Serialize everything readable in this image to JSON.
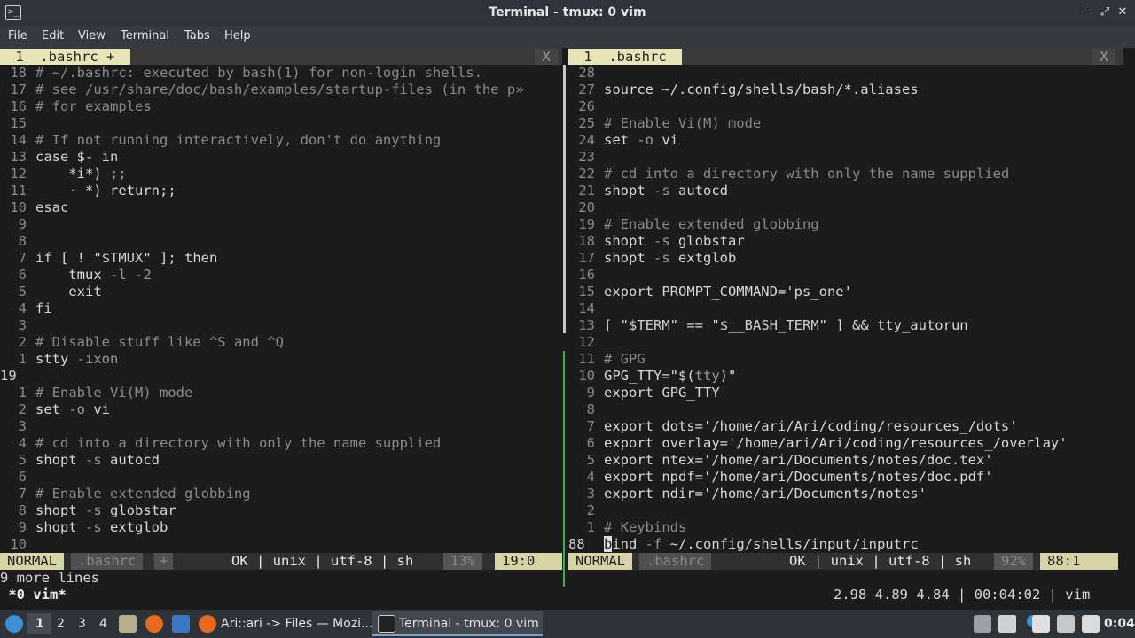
{
  "window": {
    "title": "Terminal - tmux: 0 vim",
    "min_icon": "minimize-icon",
    "max_icon": "maximize-icon",
    "close_icon": "close-icon"
  },
  "menu": [
    "File",
    "Edit",
    "View",
    "Terminal",
    "Tabs",
    "Help"
  ],
  "left_pane": {
    "tab_label": " 1  .bashrc + ",
    "tab_close": "X",
    "lines": [
      {
        "n": "18",
        "t": [
          [
            "cm",
            "# ~/.bashrc: executed by bash(1) for non-login shells."
          ]
        ]
      },
      {
        "n": "17",
        "t": [
          [
            "cm",
            "# see /usr/share/doc/bash/examples/startup-files (in the p»"
          ]
        ]
      },
      {
        "n": "16",
        "t": [
          [
            "cm",
            "# for examples"
          ]
        ]
      },
      {
        "n": "15",
        "t": []
      },
      {
        "n": "14",
        "t": [
          [
            "cm",
            "# If not running interactively, don't do anything"
          ]
        ]
      },
      {
        "n": "13",
        "t": [
          [
            "kw",
            "case "
          ],
          [
            "var",
            "$-"
          ],
          [
            "kw",
            " in"
          ]
        ]
      },
      {
        "n": "12",
        "t": [
          [
            "",
            "    *i*) "
          ],
          [
            "op",
            ";;"
          ]
        ]
      },
      {
        "n": "11",
        "t": [
          [
            "op",
            "    · "
          ],
          [
            "",
            "*) return;;"
          ]
        ]
      },
      {
        "n": "10",
        "t": [
          [
            "kw",
            "esac"
          ]
        ]
      },
      {
        "n": "9",
        "t": []
      },
      {
        "n": "8",
        "t": []
      },
      {
        "n": "7",
        "t": [
          [
            "kw",
            "if "
          ],
          [
            "",
            "[ ! \""
          ],
          [
            "var",
            "$TMUX"
          ],
          [
            "",
            "\" ]; then"
          ]
        ]
      },
      {
        "n": "6",
        "t": [
          [
            "",
            "    tmux "
          ],
          [
            "op",
            "-l -2"
          ]
        ]
      },
      {
        "n": "5",
        "t": [
          [
            "",
            "    exit"
          ]
        ]
      },
      {
        "n": "4",
        "t": [
          [
            "kw",
            "fi"
          ]
        ]
      },
      {
        "n": "3",
        "t": []
      },
      {
        "n": "2",
        "t": [
          [
            "cm",
            "# Disable stuff like ^S and ^Q"
          ]
        ]
      },
      {
        "n": "1",
        "t": [
          [
            "",
            "stty "
          ],
          [
            "op",
            "-ixon"
          ]
        ]
      },
      {
        "n": "19",
        "cur": true,
        "t": []
      },
      {
        "n": "1",
        "t": [
          [
            "cm",
            "# Enable Vi(M) mode"
          ]
        ]
      },
      {
        "n": "2",
        "t": [
          [
            "",
            "set "
          ],
          [
            "op",
            "-o"
          ],
          [
            "",
            " vi"
          ]
        ]
      },
      {
        "n": "3",
        "t": []
      },
      {
        "n": "4",
        "t": [
          [
            "cm",
            "# cd into a directory with only the name supplied"
          ]
        ]
      },
      {
        "n": "5",
        "t": [
          [
            "",
            "shopt "
          ],
          [
            "op",
            "-s"
          ],
          [
            "",
            " autocd"
          ]
        ]
      },
      {
        "n": "6",
        "t": []
      },
      {
        "n": "7",
        "t": [
          [
            "cm",
            "# Enable extended globbing"
          ]
        ]
      },
      {
        "n": "8",
        "t": [
          [
            "",
            "shopt "
          ],
          [
            "op",
            "-s"
          ],
          [
            "",
            " globstar"
          ]
        ]
      },
      {
        "n": "9",
        "t": [
          [
            "",
            "shopt "
          ],
          [
            "op",
            "-s"
          ],
          [
            "",
            " extglob"
          ]
        ]
      },
      {
        "n": "10",
        "t": []
      }
    ],
    "status": {
      "mode": "NORMAL",
      "file": ".bashrc",
      "modified": "+",
      "info": "OK | unix | utf-8 | sh",
      "percent": "13%",
      "position": "19:0"
    }
  },
  "right_pane": {
    "tab_label": " 1  .bashrc ",
    "tab_close": "X",
    "lines": [
      {
        "n": "28",
        "t": []
      },
      {
        "n": "27",
        "t": [
          [
            "",
            "source ~/.config/shells/bash/*.aliases"
          ]
        ]
      },
      {
        "n": "26",
        "t": []
      },
      {
        "n": "25",
        "t": [
          [
            "cm",
            "# Enable Vi(M) mode"
          ]
        ]
      },
      {
        "n": "24",
        "t": [
          [
            "",
            "set "
          ],
          [
            "op",
            "-o"
          ],
          [
            "",
            " vi"
          ]
        ]
      },
      {
        "n": "23",
        "t": []
      },
      {
        "n": "22",
        "t": [
          [
            "cm",
            "# cd into a directory with only the name supplied"
          ]
        ]
      },
      {
        "n": "21",
        "t": [
          [
            "",
            "shopt "
          ],
          [
            "op",
            "-s"
          ],
          [
            "",
            " autocd"
          ]
        ]
      },
      {
        "n": "20",
        "t": []
      },
      {
        "n": "19",
        "t": [
          [
            "cm",
            "# Enable extended globbing"
          ]
        ]
      },
      {
        "n": "18",
        "t": [
          [
            "",
            "shopt "
          ],
          [
            "op",
            "-s"
          ],
          [
            "",
            " globstar"
          ]
        ]
      },
      {
        "n": "17",
        "t": [
          [
            "",
            "shopt "
          ],
          [
            "op",
            "-s"
          ],
          [
            "",
            " extglob"
          ]
        ]
      },
      {
        "n": "16",
        "t": []
      },
      {
        "n": "15",
        "t": [
          [
            "",
            "export PROMPT_COMMAND='ps_one'"
          ]
        ]
      },
      {
        "n": "14",
        "t": []
      },
      {
        "n": "13",
        "t": [
          [
            "",
            "[ \""
          ],
          [
            "var",
            "$TERM"
          ],
          [
            "",
            "\" == \""
          ],
          [
            "var",
            "$__BASH_TERM"
          ],
          [
            "",
            "\" ] && tty_autorun"
          ]
        ]
      },
      {
        "n": "12",
        "t": []
      },
      {
        "n": "11",
        "t": [
          [
            "cm",
            "# GPG"
          ]
        ]
      },
      {
        "n": "10",
        "t": [
          [
            "",
            "GPG_TTY=\"$("
          ],
          [
            "op",
            "tty"
          ],
          [
            "",
            ")\""
          ]
        ]
      },
      {
        "n": "9",
        "t": [
          [
            "",
            "export GPG_TTY"
          ]
        ]
      },
      {
        "n": "8",
        "t": []
      },
      {
        "n": "7",
        "t": [
          [
            "",
            "export dots='/home/ari/Ari/coding/resources_/dots'"
          ]
        ]
      },
      {
        "n": "6",
        "t": [
          [
            "",
            "export overlay='/home/ari/Ari/coding/resources_/overlay'"
          ]
        ]
      },
      {
        "n": "5",
        "t": [
          [
            "",
            "export ntex='/home/ari/Documents/notes/doc.tex'"
          ]
        ]
      },
      {
        "n": "4",
        "t": [
          [
            "",
            "export npdf='/home/ari/Documents/notes/doc.pdf'"
          ]
        ]
      },
      {
        "n": "3",
        "t": [
          [
            "",
            "export ndir='/home/ari/Documents/notes'"
          ]
        ]
      },
      {
        "n": "2",
        "t": []
      },
      {
        "n": "1",
        "t": [
          [
            "cm",
            "# Keybinds"
          ]
        ]
      },
      {
        "n": "88",
        "cur": true,
        "cursor_char": "b",
        "t": [
          [
            "",
            "ind "
          ],
          [
            "op",
            "-f"
          ],
          [
            "",
            " ~/.config/shells/input/inputrc"
          ]
        ]
      }
    ],
    "status": {
      "mode": "NORMAL",
      "file": ".bashrc",
      "info": "OK | unix | utf-8 | sh",
      "percent": "92%",
      "position": "88:1"
    }
  },
  "cmdline": "9 more lines",
  "tmux": {
    "window_label": " *0 vim*",
    "right_info": "2.98 4.89 4.84 | 00:04:02 | vim"
  },
  "taskbar": {
    "workspaces": [
      "1",
      "2",
      "3",
      "4"
    ],
    "tasks": [
      {
        "label": "Ari::ari -> Files — Mozi...",
        "icon": "firefox-icon"
      },
      {
        "label": "Terminal - tmux: 0 vim",
        "icon": "terminal-icon"
      }
    ],
    "clock": "0:04"
  }
}
